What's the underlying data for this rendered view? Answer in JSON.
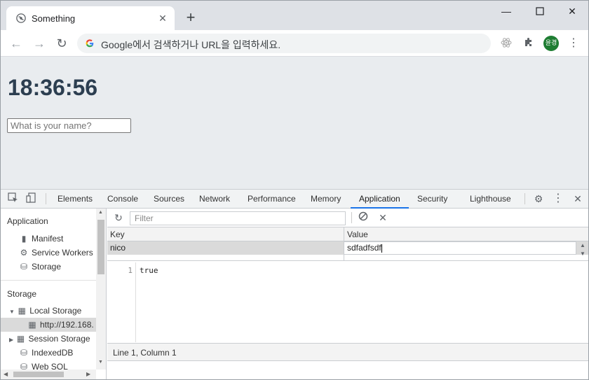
{
  "browser": {
    "tab_title": "Something",
    "tab_close": "✕",
    "new_tab": "+",
    "omnibox_text": "Google에서 검색하거나 URL을 입력하세요.",
    "profile_initials": "윤경"
  },
  "page": {
    "clock": "18:36:56",
    "name_placeholder": "What is your name?",
    "background": "#e9ecef",
    "clock_color": "#2c3e50"
  },
  "devtools": {
    "tabs": [
      "Elements",
      "Console",
      "Sources",
      "Network",
      "Performance",
      "Memory",
      "Application",
      "Security",
      "Lighthouse"
    ],
    "active_tab": "Application",
    "accent": "#1a73e8",
    "sidebar": {
      "application_heading": "Application",
      "application_items": [
        "Manifest",
        "Service Workers",
        "Storage"
      ],
      "storage_heading": "Storage",
      "local_storage": "Local Storage",
      "local_storage_origin": "http://192.168.",
      "session_storage": "Session Storage",
      "indexeddb": "IndexedDB",
      "websql": "Web SQL"
    },
    "storage": {
      "filter_placeholder": "Filter",
      "columns": {
        "key": "Key",
        "value": "Value"
      },
      "rows": [
        {
          "key": "nico",
          "value": "sdfadfsdf"
        }
      ],
      "preview_line_number": "1",
      "preview_code": "true",
      "status": "Line 1, Column 1"
    }
  }
}
